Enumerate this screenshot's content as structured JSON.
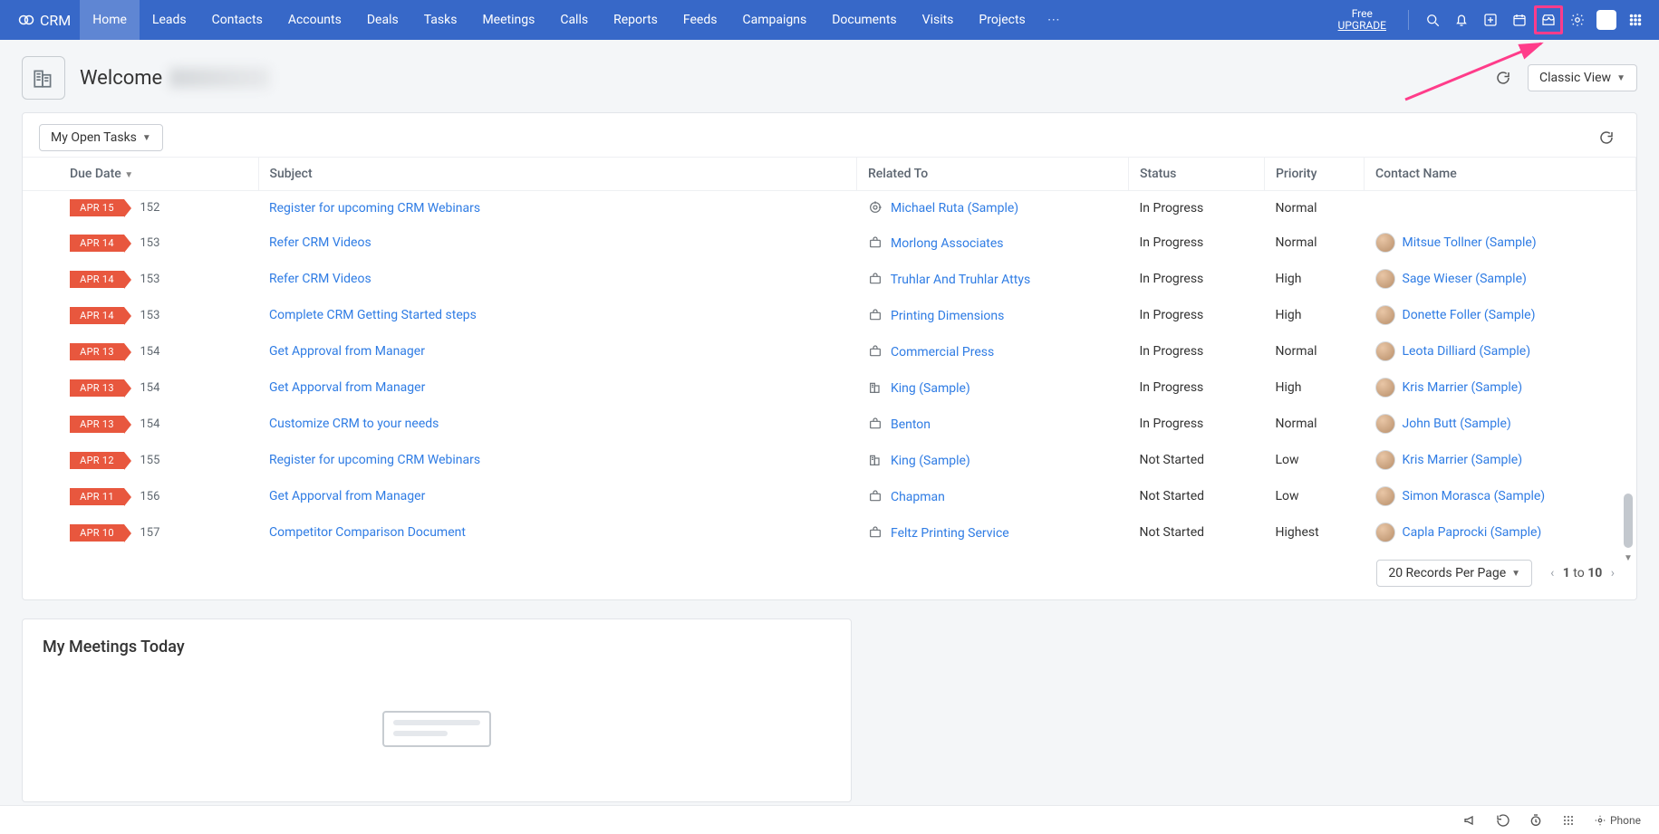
{
  "brand": "CRM",
  "nav": [
    "Home",
    "Leads",
    "Contacts",
    "Accounts",
    "Deals",
    "Tasks",
    "Meetings",
    "Calls",
    "Reports",
    "Feeds",
    "Campaigns",
    "Documents",
    "Visits",
    "Projects"
  ],
  "nav_active": 0,
  "upgrade": {
    "line1": "Free",
    "line2": "UPGRADE"
  },
  "welcome": {
    "title": "Welcome"
  },
  "view": {
    "classic": "Classic View"
  },
  "tasklist": {
    "filter_label": "My Open Tasks",
    "headers": [
      "",
      "Due Date",
      "Subject",
      "Related To",
      "Status",
      "Priority",
      "Contact Name"
    ],
    "rows": [
      {
        "date": "APR 15",
        "days": "152",
        "subject": "Register for upcoming CRM Webinars",
        "rel_icon": "target",
        "related": "Michael Ruta (Sample)",
        "status": "In Progress",
        "priority": "Normal",
        "contact": ""
      },
      {
        "date": "APR 14",
        "days": "153",
        "subject": "Refer CRM Videos",
        "rel_icon": "briefcase",
        "related": "Morlong Associates",
        "status": "In Progress",
        "priority": "Normal",
        "contact": "Mitsue Tollner (Sample)"
      },
      {
        "date": "APR 14",
        "days": "153",
        "subject": "Refer CRM Videos",
        "rel_icon": "briefcase",
        "related": "Truhlar And Truhlar Attys",
        "status": "In Progress",
        "priority": "High",
        "contact": "Sage Wieser (Sample)"
      },
      {
        "date": "APR 14",
        "days": "153",
        "subject": "Complete CRM Getting Started steps",
        "rel_icon": "briefcase",
        "related": "Printing Dimensions",
        "status": "In Progress",
        "priority": "High",
        "contact": "Donette Foller (Sample)"
      },
      {
        "date": "APR 13",
        "days": "154",
        "subject": "Get Approval from Manager",
        "rel_icon": "briefcase",
        "related": "Commercial Press",
        "status": "In Progress",
        "priority": "Normal",
        "contact": "Leota Dilliard (Sample)"
      },
      {
        "date": "APR 13",
        "days": "154",
        "subject": "Get Apporval from Manager",
        "rel_icon": "building",
        "related": "King (Sample)",
        "status": "In Progress",
        "priority": "High",
        "contact": "Kris Marrier (Sample)"
      },
      {
        "date": "APR 13",
        "days": "154",
        "subject": "Customize CRM to your needs",
        "rel_icon": "briefcase",
        "related": "Benton",
        "status": "In Progress",
        "priority": "Normal",
        "contact": "John Butt (Sample)"
      },
      {
        "date": "APR 12",
        "days": "155",
        "subject": "Register for upcoming CRM Webinars",
        "rel_icon": "building",
        "related": "King (Sample)",
        "status": "Not Started",
        "priority": "Low",
        "contact": "Kris Marrier (Sample)"
      },
      {
        "date": "APR 11",
        "days": "156",
        "subject": "Get Apporval from Manager",
        "rel_icon": "briefcase",
        "related": "Chapman",
        "status": "Not Started",
        "priority": "Low",
        "contact": "Simon Morasca (Sample)"
      },
      {
        "date": "APR 10",
        "days": "157",
        "subject": "Competitor Comparison Document",
        "rel_icon": "briefcase",
        "related": "Feltz Printing Service",
        "status": "Not Started",
        "priority": "Highest",
        "contact": "Capla Paprocki (Sample)"
      }
    ],
    "per_page": "20 Records Per Page",
    "pager_from": "1",
    "pager_to": "10",
    "pager_sep": "to"
  },
  "meetings": {
    "title": "My Meetings Today"
  },
  "osbar": {
    "phone": "Phone"
  }
}
